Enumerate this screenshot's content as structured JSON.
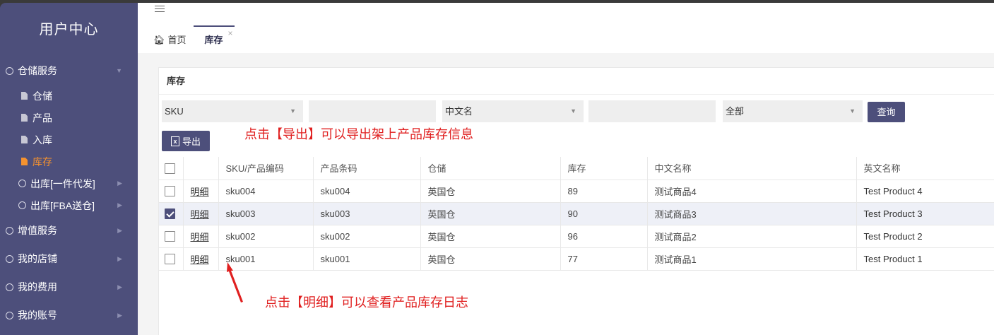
{
  "sidebar": {
    "title": "用户中心",
    "items": [
      {
        "label": "仓储服务",
        "type": "group",
        "caret": "▼"
      },
      {
        "label": "仓储",
        "type": "sub"
      },
      {
        "label": "产品",
        "type": "sub"
      },
      {
        "label": "入库",
        "type": "sub"
      },
      {
        "label": "库存",
        "type": "sub",
        "active": true
      },
      {
        "label": "出库[一件代发]",
        "type": "sub2",
        "caret": "▶"
      },
      {
        "label": "出库[FBA送仓]",
        "type": "sub2",
        "caret": "▶"
      },
      {
        "label": "增值服务",
        "type": "group",
        "caret": "▶"
      },
      {
        "label": "我的店铺",
        "type": "group",
        "caret": "▶"
      },
      {
        "label": "我的费用",
        "type": "group",
        "caret": "▶"
      },
      {
        "label": "我的账号",
        "type": "group",
        "caret": "▶"
      }
    ]
  },
  "tabs": {
    "home": "首页",
    "active": "库存",
    "close": "×"
  },
  "panel": {
    "title": "库存",
    "filters": {
      "field1": "SKU",
      "field1_value": "",
      "field2": "中文名",
      "field2_value": "",
      "status": "全部",
      "query": "查询"
    },
    "export": "导出",
    "annotation_export": "点击【导出】可以导出架上产品库存信息",
    "annotation_detail": "点击【明细】可以查看产品库存日志"
  },
  "table": {
    "headers": [
      "SKU/产品编码",
      "产品条码",
      "仓储",
      "库存",
      "中文名称",
      "英文名称"
    ],
    "detail_label": "明细",
    "rows": [
      {
        "checked": false,
        "sku": "sku004",
        "barcode": "sku004",
        "warehouse": "英国仓",
        "stock": "89",
        "cn": "测试商品4",
        "en": "Test Product 4"
      },
      {
        "checked": true,
        "sku": "sku003",
        "barcode": "sku003",
        "warehouse": "英国仓",
        "stock": "90",
        "cn": "测试商品3",
        "en": "Test Product 3"
      },
      {
        "checked": false,
        "sku": "sku002",
        "barcode": "sku002",
        "warehouse": "英国仓",
        "stock": "96",
        "cn": "测试商品2",
        "en": "Test Product 2"
      },
      {
        "checked": false,
        "sku": "sku001",
        "barcode": "sku001",
        "warehouse": "英国仓",
        "stock": "77",
        "cn": "测试商品1",
        "en": "Test Product 1"
      }
    ]
  },
  "colors": {
    "sidebar": "#4d4f7b",
    "active": "#f5922f",
    "annotation": "#e02020"
  }
}
